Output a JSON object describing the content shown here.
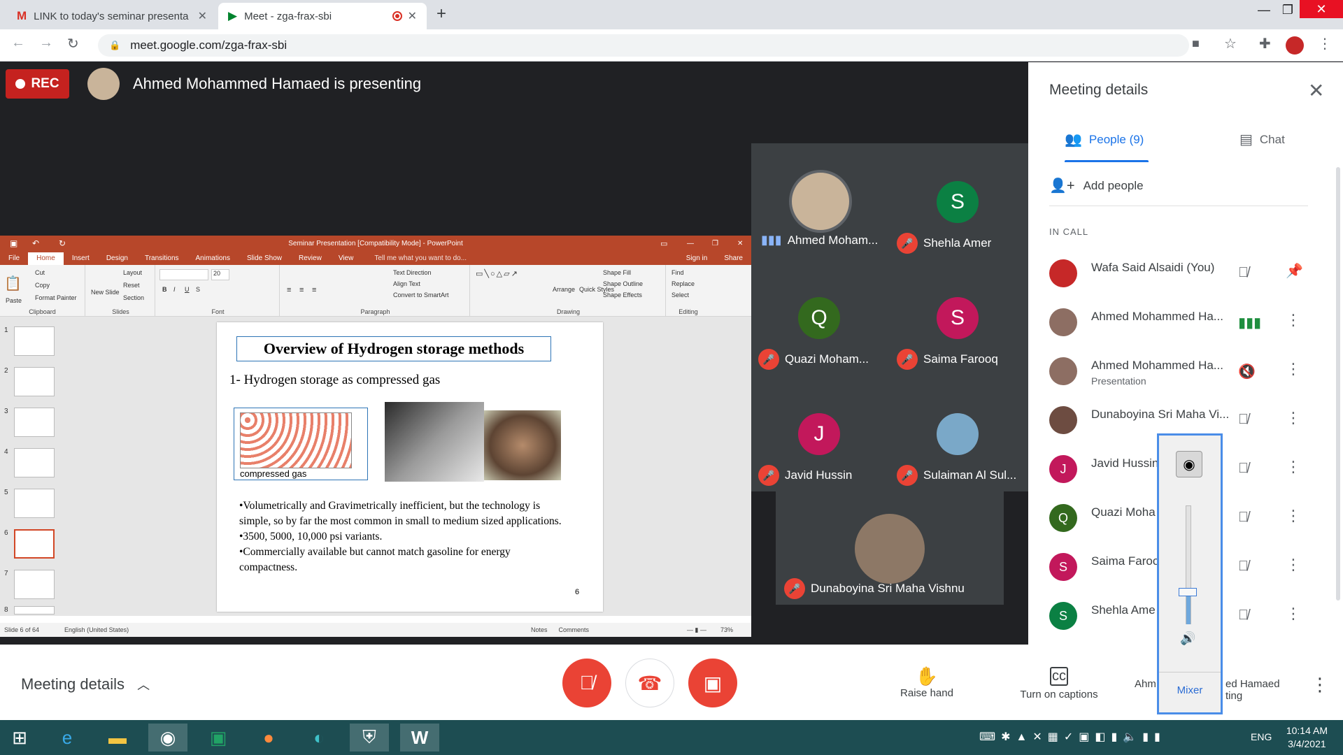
{
  "browser": {
    "tabs": [
      {
        "title": "LINK to today's seminar presenta",
        "active": false
      },
      {
        "title": "Meet - zga-frax-sbi",
        "active": true
      }
    ],
    "url": "meet.google.com/zga-frax-sbi"
  },
  "meet": {
    "rec_label": "REC",
    "presenting_text": "Ahmed Mohammed Hamaed is presenting"
  },
  "ppt": {
    "window_title": "Seminar Presentation [Compatibility Mode] - PowerPoint",
    "tabs": [
      "File",
      "Home",
      "Insert",
      "Design",
      "Transitions",
      "Animations",
      "Slide Show",
      "Review",
      "View"
    ],
    "tell_me": "Tell me what you want to do...",
    "sign_in": "Sign in",
    "share": "Share",
    "ribbon": {
      "clipboard": "Clipboard",
      "paste": "Paste",
      "cut": "Cut",
      "copy": "Copy",
      "format_painter": "Format Painter",
      "slides": "Slides",
      "new_slide": "New Slide",
      "layout": "Layout",
      "reset": "Reset",
      "section": "Section",
      "font": "Font",
      "font_size": "20",
      "paragraph": "Paragraph",
      "text_direction": "Text Direction",
      "align_text": "Align Text",
      "convert_smartart": "Convert to SmartArt",
      "drawing": "Drawing",
      "arrange": "Arrange",
      "quick_styles": "Quick Styles",
      "shape_fill": "Shape Fill",
      "shape_outline": "Shape Outline",
      "shape_effects": "Shape Effects",
      "editing": "Editing",
      "find": "Find",
      "replace": "Replace",
      "select": "Select"
    },
    "thumbnails": [
      "1",
      "2",
      "3",
      "4",
      "5",
      "6",
      "7",
      "8"
    ],
    "slide": {
      "title": "Overview of Hydrogen storage methods",
      "subtitle": "1- Hydrogen storage as compressed gas",
      "image_caption": "compressed gas",
      "bullets": [
        "•Volumetrically and Gravimetrically inefficient, but the technology is simple, so by far the most common in small to medium sized applications.",
        "•3500, 5000, 10,000 psi variants.",
        "•Commercially available but cannot match gasoline for energy compactness."
      ],
      "number": "6"
    },
    "status": {
      "slide_of": "Slide 6 of 64",
      "language": "English (United States)",
      "notes": "Notes",
      "comments": "Comments",
      "zoom": "73%"
    }
  },
  "tiles": [
    {
      "name": "Ahmed Moham...",
      "initial": "",
      "color": "#8ab4f8"
    },
    {
      "name": "Shehla Amer",
      "initial": "S",
      "color": "#0b8043"
    },
    {
      "name": "Quazi Moham...",
      "initial": "Q",
      "color": "#33691e"
    },
    {
      "name": "Saima Farooq",
      "initial": "S",
      "color": "#c2185b"
    },
    {
      "name": "Javid Hussin",
      "initial": "J",
      "color": "#c2185b"
    },
    {
      "name": "Sulaiman Al Sul...",
      "initial": "",
      "color": "#8ab4f8"
    },
    {
      "name": "Dunaboyina Sri Maha Vishnu",
      "initial": "",
      "color": "#8ab4f8"
    }
  ],
  "panel": {
    "title": "Meeting details",
    "tab_people": "People (9)",
    "tab_chat": "Chat",
    "add_people": "Add people",
    "in_call": "IN CALL",
    "people": [
      {
        "name": "Wafa Said Alsaidi (You)",
        "sub": "",
        "initial": "",
        "color": "#c62828"
      },
      {
        "name": "Ahmed Mohammed Ha...",
        "sub": "",
        "initial": "",
        "color": "#8d6e63"
      },
      {
        "name": "Ahmed Mohammed Ha...",
        "sub": "Presentation",
        "initial": "",
        "color": "#8d6e63"
      },
      {
        "name": "Dunaboyina Sri Maha Vi...",
        "sub": "",
        "initial": "",
        "color": "#6d4c41"
      },
      {
        "name": "Javid Hussin",
        "sub": "",
        "initial": "J",
        "color": "#c2185b"
      },
      {
        "name": "Quazi Moha",
        "sub": "",
        "initial": "Q",
        "color": "#33691e"
      },
      {
        "name": "Saima Faroo",
        "sub": "",
        "initial": "S",
        "color": "#c2185b"
      },
      {
        "name": "Shehla Ame",
        "sub": "",
        "initial": "S",
        "color": "#0b8043"
      }
    ]
  },
  "mixer": {
    "label": "Mixer",
    "level": 0.27
  },
  "bottom": {
    "meeting_details": "Meeting details",
    "raise_hand": "Raise hand",
    "captions": "Turn on captions",
    "presenting_1": "Ahm",
    "presenting_2": "ed Hamaed",
    "presenting_3": "ting"
  },
  "taskbar": {
    "time": "10:14 AM",
    "date": "3/4/2021",
    "lang": "ENG"
  }
}
